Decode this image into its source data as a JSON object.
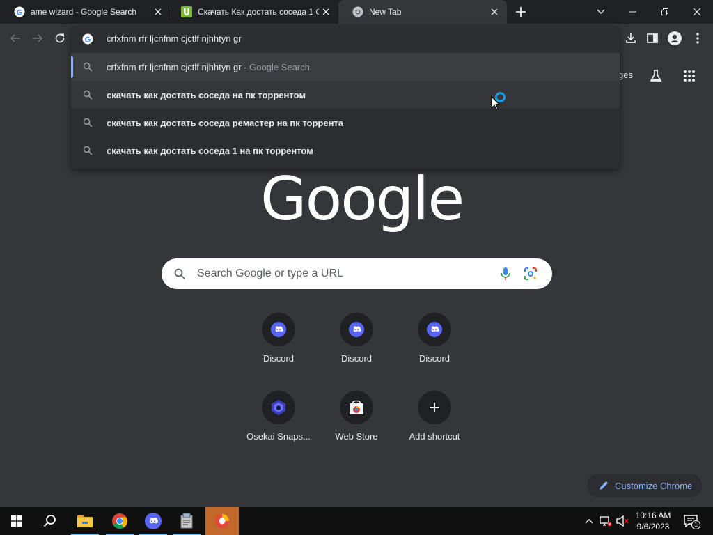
{
  "tabs": [
    {
      "title": "ame wizard - Google Search",
      "favicon": "google-g-icon"
    },
    {
      "title": "Скачать Как достать соседа 1 С/",
      "favicon": "utorrent-icon"
    },
    {
      "title": "New Tab",
      "favicon": "chrome-icon",
      "active": true
    }
  ],
  "omnibox": {
    "value": "crfxfnm rfr ljcnfnm cjctlf njhhtyn gr",
    "suggestions": [
      {
        "text": "crfxfnm rfr ljcnfnm cjctlf njhhtyn gr",
        "suffix": " - Google Search"
      },
      {
        "text": "скачать как достать соседа на пк торрентом"
      },
      {
        "text": "скачать как достать соседа ремастер на пк торрента"
      },
      {
        "text": "скачать как достать соседа 1 на пк торрентом"
      }
    ]
  },
  "ntp": {
    "header_link_partial": "ges",
    "logo_text": "Google",
    "search_placeholder": "Search Google or type a URL",
    "shortcuts": [
      {
        "label": "Discord",
        "icon": "discord-icon"
      },
      {
        "label": "Discord",
        "icon": "discord-icon"
      },
      {
        "label": "Discord",
        "icon": "discord-icon"
      },
      {
        "label": "Osekai Snaps...",
        "icon": "osekai-icon"
      },
      {
        "label": "Web Store",
        "icon": "web-store-icon"
      },
      {
        "label": "Add shortcut",
        "icon": "plus-icon"
      }
    ],
    "customize_label": "Customize Chrome"
  },
  "taskbar": {
    "time": "10:16 AM",
    "date": "9/6/2023",
    "notification_count": "1"
  },
  "colors": {
    "accent_blue": "#8ab4f8",
    "discord_blurple": "#5865f2",
    "background": "#35363a",
    "tabstrip": "#202124"
  }
}
